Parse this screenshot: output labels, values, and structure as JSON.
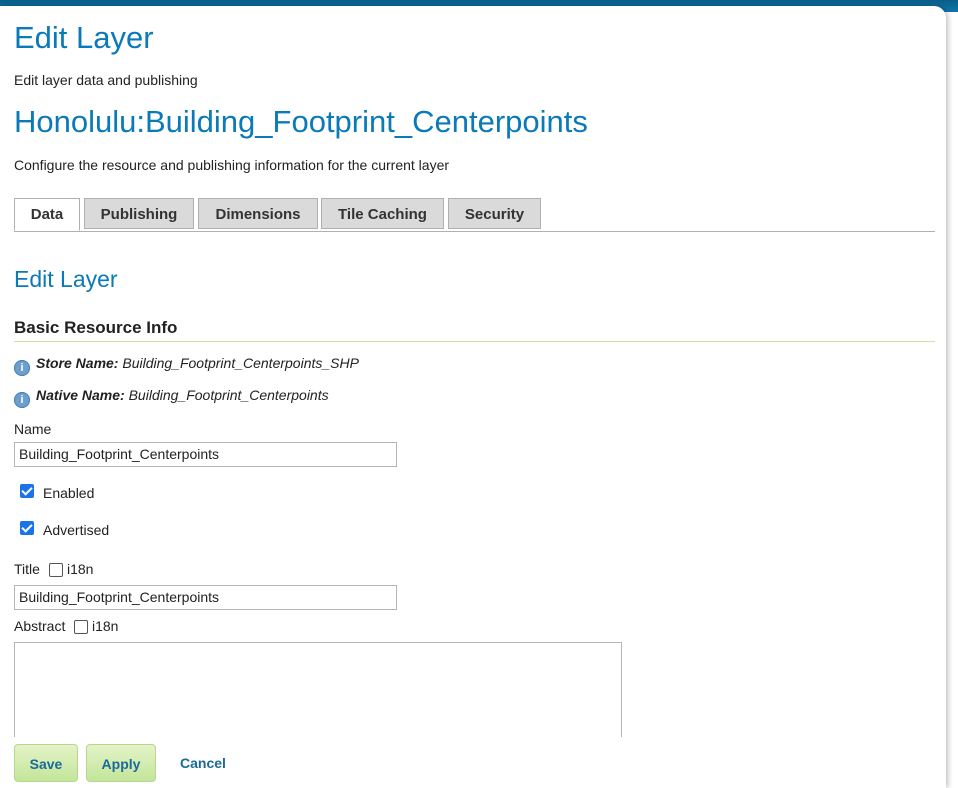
{
  "header": {
    "title": "Edit Layer",
    "subtitle": "Edit layer data and publishing",
    "layer_name": "Honolulu:Building_Footprint_Centerpoints",
    "layer_description": "Configure the resource and publishing information for the current layer"
  },
  "tabs": [
    {
      "label": "Data",
      "active": true
    },
    {
      "label": "Publishing",
      "active": false
    },
    {
      "label": "Dimensions",
      "active": false
    },
    {
      "label": "Tile Caching",
      "active": false
    },
    {
      "label": "Security",
      "active": false
    }
  ],
  "content": {
    "heading": "Edit Layer",
    "section_title": "Basic Resource Info",
    "store_name_label": "Store Name:",
    "store_name_value": "Building_Footprint_Centerpoints_SHP",
    "native_name_label": "Native Name:",
    "native_name_value": "Building_Footprint_Centerpoints",
    "name_label": "Name",
    "name_value": "Building_Footprint_Centerpoints",
    "enabled_label": "Enabled",
    "enabled_checked": true,
    "advertised_label": "Advertised",
    "advertised_checked": true,
    "title_label": "Title",
    "title_i18n_label": "i18n",
    "title_value": "Building_Footprint_Centerpoints",
    "abstract_label": "Abstract",
    "abstract_i18n_label": "i18n",
    "abstract_value": ""
  },
  "footer": {
    "save_label": "Save",
    "apply_label": "Apply",
    "cancel_label": "Cancel"
  },
  "colors": {
    "accent": "#0a7ab8",
    "topbar": "#0e76ad",
    "button_bg": "#c3e59a",
    "checkbox": "#1a73e8"
  },
  "icons": {
    "info": "info-icon"
  }
}
